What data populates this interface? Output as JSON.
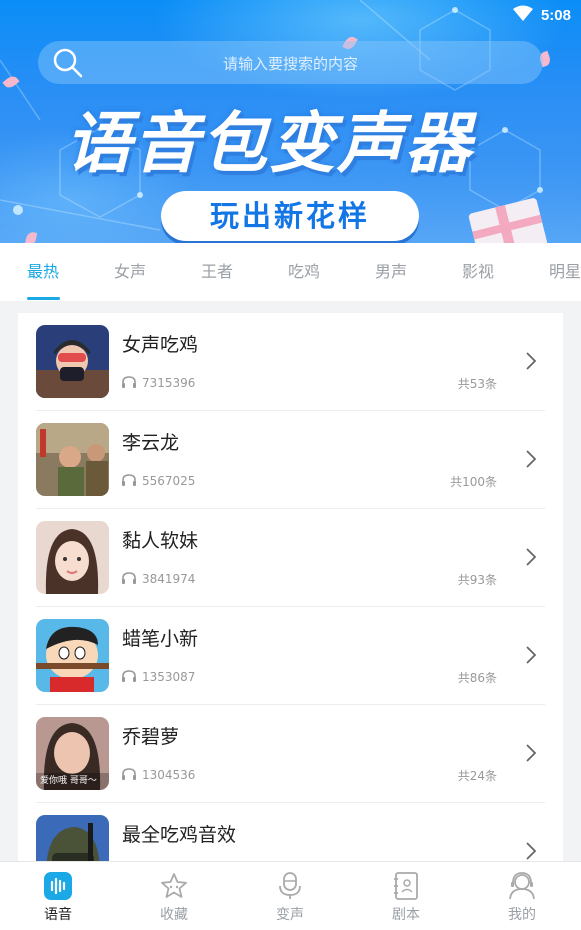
{
  "status_bar": {
    "time": "5:08",
    "wifi_icon": "wifi-icon"
  },
  "search": {
    "placeholder": "请输入要搜索的内容",
    "icon": "search-icon"
  },
  "banner": {
    "title": "语音包变声器",
    "subtitle": "玩出新花样"
  },
  "tabs": [
    {
      "label": "最热",
      "active": true
    },
    {
      "label": "女声"
    },
    {
      "label": "王者"
    },
    {
      "label": "吃鸡"
    },
    {
      "label": "男声"
    },
    {
      "label": "影视"
    },
    {
      "label": "明星"
    }
  ],
  "list": [
    {
      "title": "女声吃鸡",
      "plays": "7315396",
      "count": "共53条",
      "thumb": "avatar-girl-goggles"
    },
    {
      "title": "李云龙",
      "plays": "5567025",
      "count": "共100条",
      "thumb": "avatar-soldiers"
    },
    {
      "title": "黏人软妹",
      "plays": "3841974",
      "count": "共93条",
      "thumb": "avatar-girl"
    },
    {
      "title": "蜡笔小新",
      "plays": "1353087",
      "count": "共86条",
      "thumb": "avatar-cartoon-boy"
    },
    {
      "title": "乔碧萝",
      "plays": "1304536",
      "count": "共24条",
      "thumb": "avatar-woman",
      "thumb_caption": "爱你哦 哥哥～"
    },
    {
      "title": "最全吃鸡音效",
      "plays": "",
      "count": "",
      "thumb": "avatar-helmet"
    }
  ],
  "bottom_nav": [
    {
      "label": "语音",
      "icon": "voice-icon",
      "active": true
    },
    {
      "label": "收藏",
      "icon": "star-icon"
    },
    {
      "label": "变声",
      "icon": "microphone-icon"
    },
    {
      "label": "剧本",
      "icon": "script-book-icon"
    },
    {
      "label": "我的",
      "icon": "profile-icon"
    }
  ],
  "colors": {
    "accent": "#1aa9e6",
    "banner": "#1e8ff5",
    "text": "#222222",
    "muted": "#9aa0a6"
  }
}
